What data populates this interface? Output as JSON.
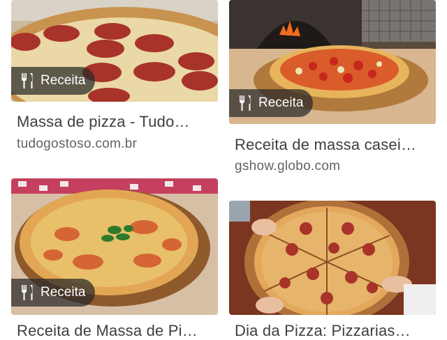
{
  "results": [
    {
      "badge": "Receita",
      "title": "Massa de pizza - Tudo…",
      "source": "tudogostoso.com.br",
      "image_icon": "pepperoni-pizza"
    },
    {
      "badge": "Receita",
      "title": "Receita de massa casei…",
      "source": "gshow.globo.com",
      "image_icon": "pizza-oven"
    },
    {
      "badge": "Receita",
      "title": "Receita de Massa de Pi…",
      "source": "",
      "image_icon": "basil-pizza"
    },
    {
      "badge": "",
      "title": "Dia da Pizza: Pizzarias…",
      "source": "",
      "image_icon": "sliced-pepperoni-pizza"
    }
  ],
  "icons": {
    "badge": "fork-knife-icon"
  }
}
